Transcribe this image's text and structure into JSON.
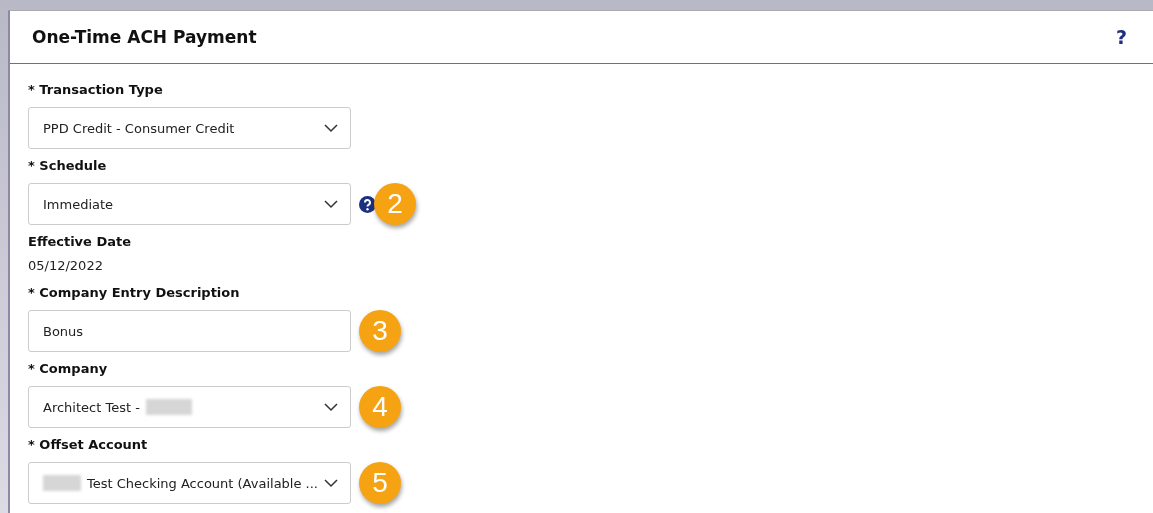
{
  "panel": {
    "title": "One-Time ACH Payment",
    "help": "?"
  },
  "fields": [
    {
      "kind": "select",
      "label": "* Transaction Type",
      "value": "PPD Credit - Consumer Credit"
    },
    {
      "kind": "select",
      "label": "* Schedule",
      "value": "Immediate",
      "help": true,
      "badge": "2"
    },
    {
      "kind": "static",
      "label": "Effective Date",
      "value": "05/12/2022"
    },
    {
      "kind": "input",
      "label": "* Company Entry Description",
      "value": "Bonus",
      "badge": "3"
    },
    {
      "kind": "select",
      "label": "* Company",
      "value": "Architect Test -",
      "redacted_suffix": true,
      "badge": "4"
    },
    {
      "kind": "select",
      "label": "* Offset Account",
      "value": "Test Checking Account (Available ...",
      "redacted_prefix": true,
      "badge": "5"
    }
  ]
}
